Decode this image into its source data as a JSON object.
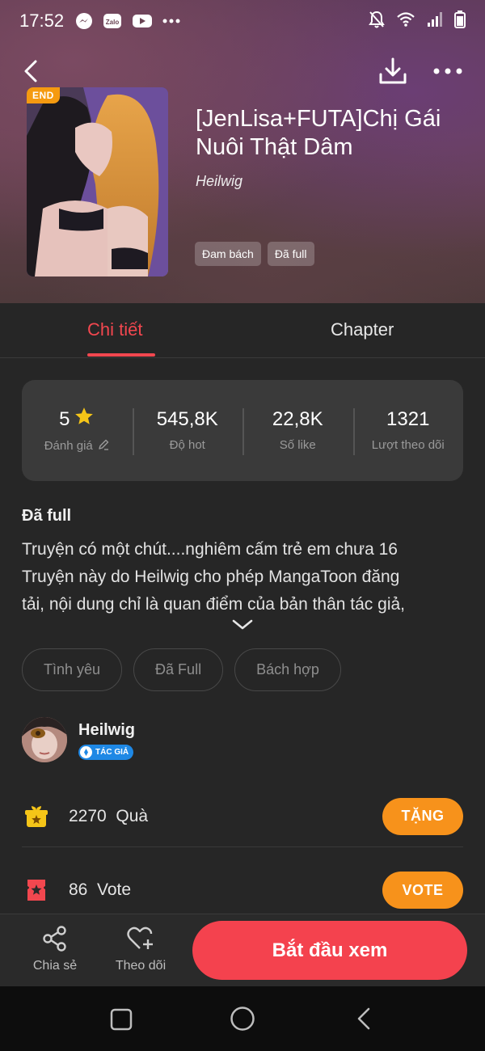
{
  "status_bar": {
    "time": "17:52",
    "app_icons": [
      "messenger-icon",
      "zalo-icon",
      "youtube-icon",
      "more-dots-icon"
    ],
    "zalo_label": "Zalo",
    "right_icons": [
      "mute-bell-icon",
      "wifi-icon",
      "signal-icon",
      "battery-icon"
    ]
  },
  "top_nav": {
    "back": "back-arrow-icon",
    "download": "download-icon",
    "more": "more-icon"
  },
  "manga": {
    "cover_badge": "END",
    "title": "[JenLisa+FUTA]Chị Gái Nuôi Thật Dâm",
    "author": "Heilwig",
    "genre_chips": [
      "Đam bách",
      "Đã full"
    ]
  },
  "tabs": [
    {
      "label": "Chi tiết",
      "active": true
    },
    {
      "label": "Chapter",
      "active": false
    }
  ],
  "stats": [
    {
      "value": "5",
      "label": "Đánh giá"
    },
    {
      "value": "545,8K",
      "label": "Độ hot"
    },
    {
      "value": "22,8K",
      "label": "Số like"
    },
    {
      "value": "1321",
      "label": "Lượt theo dõi"
    }
  ],
  "description": {
    "status": "Đã full",
    "lines": [
      "Truyện có một chút....nghiêm cấm trẻ em chưa 16",
      "Truyện này do Heilwig cho phép MangaToon đăng",
      "tải, nội dung chỉ là quan điểm của bản thân tác giả,"
    ]
  },
  "tags": [
    "Tình yêu",
    "Đã Full",
    "Bách hợp"
  ],
  "author_card": {
    "name": "Heilwig",
    "badge": "TÁC GIẢ"
  },
  "gift": {
    "count": "2270",
    "unit": "Quà",
    "button": "TẶNG"
  },
  "vote": {
    "count": "86",
    "unit": "Vote",
    "button": "VOTE"
  },
  "bottom_bar": {
    "share_label": "Chia sẻ",
    "follow_label": "Theo dõi",
    "start_label": "Bắt đầu xem"
  },
  "colors": {
    "accent_red": "#f2474f",
    "accent_orange": "#f7921b",
    "star_yellow": "#f5c518",
    "author_badge_blue": "#1e88e5"
  }
}
